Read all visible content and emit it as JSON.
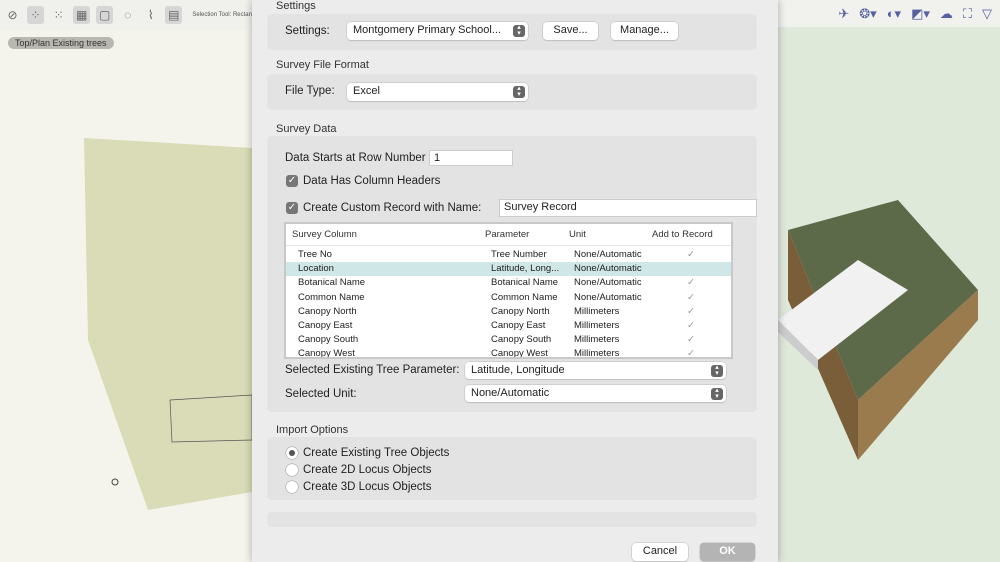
{
  "toolbar": {
    "selection_tool_label": "Selection Tool: Rectan"
  },
  "view": {
    "label": "Top/Plan  Existing trees"
  },
  "dialog": {
    "settings": {
      "section": "Settings",
      "label": "Settings:",
      "value": "Montgomery Primary School...",
      "save": "Save...",
      "manage": "Manage..."
    },
    "file_format": {
      "section": "Survey File Format",
      "label": "File Type:",
      "value": "Excel"
    },
    "survey_data": {
      "section": "Survey Data",
      "start_row_label": "Data Starts at Row Number",
      "start_row_value": "1",
      "headers_label": "Data Has Column Headers",
      "headers_checked": true,
      "custom_record_label": "Create Custom Record with Name:",
      "custom_record_checked": true,
      "custom_record_value": "Survey Record",
      "table": {
        "columns": [
          "Survey Column",
          "Parameter",
          "Unit",
          "Add to Record"
        ],
        "rows": [
          {
            "col": "Tree No",
            "param": "Tree Number",
            "unit": "None/Automatic",
            "add": "✓"
          },
          {
            "col": "Location",
            "param": "Latitude, Long...",
            "unit": "None/Automatic",
            "add": ""
          },
          {
            "col": "Botanical Name",
            "param": "Botanical Name",
            "unit": "None/Automatic",
            "add": "✓"
          },
          {
            "col": "Common Name",
            "param": "Common Name",
            "unit": "None/Automatic",
            "add": "✓"
          },
          {
            "col": "Canopy North",
            "param": "Canopy North",
            "unit": "Millimeters",
            "add": "✓"
          },
          {
            "col": "Canopy East",
            "param": "Canopy East",
            "unit": "Millimeters",
            "add": "✓"
          },
          {
            "col": "Canopy South",
            "param": "Canopy South",
            "unit": "Millimeters",
            "add": "✓"
          },
          {
            "col": "Canopy West",
            "param": "Canopy West",
            "unit": "Millimeters",
            "add": "✓"
          }
        ]
      },
      "param_label": "Selected Existing Tree Parameter:",
      "param_value": "Latitude, Longitude",
      "unit_label": "Selected Unit:",
      "unit_value": "None/Automatic"
    },
    "import": {
      "section": "Import Options",
      "options": [
        "Create Existing Tree Objects",
        "Create 2D Locus Objects",
        "Create 3D Locus Objects"
      ],
      "selected": 0
    },
    "cancel": "Cancel",
    "ok": "OK"
  }
}
